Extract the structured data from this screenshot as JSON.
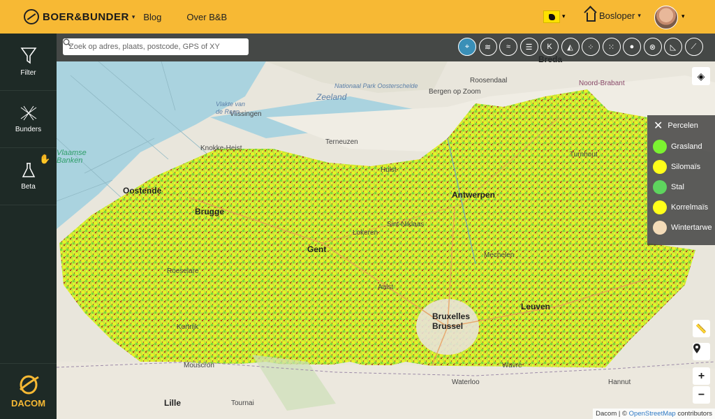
{
  "header": {
    "brand": "BOER&BUNDER",
    "nav": [
      {
        "label": "Blog"
      },
      {
        "label": "Over B&B"
      }
    ],
    "user_label": "Bosloper"
  },
  "sidebar": {
    "items": [
      {
        "label": "Filter",
        "icon": "funnel-icon"
      },
      {
        "label": "Bunders",
        "icon": "fields-icon"
      },
      {
        "label": "Beta",
        "icon": "flask-icon"
      }
    ],
    "footer_label": "DACOM"
  },
  "search": {
    "placeholder": "Zoek op adres, plaats, postcode, GPS of XY"
  },
  "toolbar": {
    "icons": [
      "location-pin-icon",
      "rainfall-icon",
      "soil-icon",
      "list-icon",
      "k-icon",
      "elevation-icon",
      "nutrients-icon",
      "seeds-icon",
      "water-drop-icon",
      "analysis-icon",
      "slope-icon",
      "erosion-icon"
    ]
  },
  "legend": {
    "title": "Percelen",
    "items": [
      {
        "label": "Grasland",
        "color": "#7cf230"
      },
      {
        "label": "Silomaïs",
        "color": "#ffff1a"
      },
      {
        "label": "Stal",
        "color": "#5ed45e"
      },
      {
        "label": "Korrelmaïs",
        "color": "#ffff1a"
      },
      {
        "label": "Wintertarwe",
        "color": "#f3dbb8"
      }
    ]
  },
  "map": {
    "labels": {
      "oostende": "Oostende",
      "brugge": "Brugge",
      "gent": "Gent",
      "antwerpen": "Antwerpen",
      "brussels": "Bruxelles\nBrussel",
      "leuven": "Leuven",
      "lille": "Lille",
      "vlissingen": "Vlissingen",
      "terneuzen": "Terneuzen",
      "hulst": "Hulst",
      "mechelen": "Mechelen",
      "aalst": "Aalst",
      "zeeland": "Zeeland",
      "breda": "Breda",
      "kortrijk": "Kortrijk",
      "tournai": "Tournai",
      "noordbrabant": "Noord-Brabant",
      "turnhout": "Turnhout",
      "waterloo": "Waterloo",
      "roeselare": "Roeselare",
      "mouscron": "Mouscron",
      "knokke": "Knokke-Heist",
      "oosterschelde": "Nationaal Park Oosterschelde",
      "vlakte": "Vlakte van\nde Raan",
      "banken": "Vlaamse\nBanken",
      "roosendaal": "Roosendaal",
      "bergen": "Bergen op Zoom",
      "hannut": "Hannut",
      "wavre": "Wavre",
      "sint_niklaas": "Sint-Niklaas",
      "lokeren": "Lokeren"
    },
    "attribution_prefix": "Dacom | ©",
    "attribution_link": "OpenStreetMap",
    "attribution_suffix": "contributors"
  }
}
